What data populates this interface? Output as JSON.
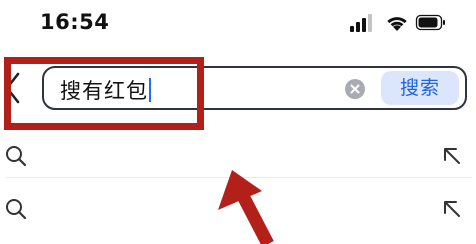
{
  "status_bar": {
    "time": "16:54",
    "icons": [
      "cellular-signal-icon",
      "wifi-icon",
      "battery-icon"
    ]
  },
  "search": {
    "back_icon": "chevron-left-icon",
    "query": "搜有红包",
    "clear_icon": "clear-circle-icon",
    "button_label": "搜索"
  },
  "suggestions": [
    {
      "icon": "search-icon",
      "action_icon": "fill-arrow-icon"
    },
    {
      "icon": "search-icon",
      "action_icon": "fill-arrow-icon"
    }
  ],
  "annotations": {
    "highlight_color": "#b3201a",
    "arrow_color": "#b3201a"
  },
  "colors": {
    "accent": "#1e63e0",
    "search_button_bg": "#dbe6fd",
    "caret": "#1e6cff"
  }
}
